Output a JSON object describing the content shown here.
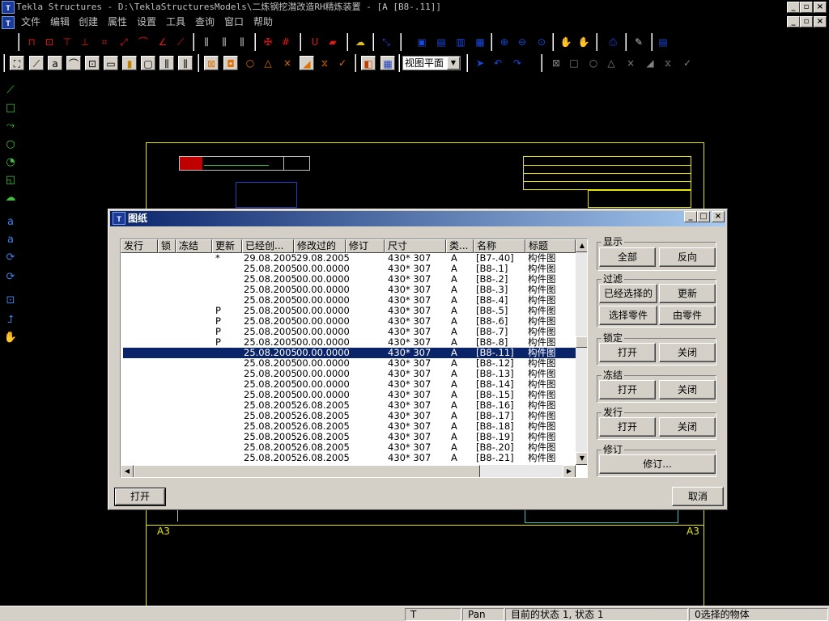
{
  "window": {
    "title": "Tekla Structures - D:\\TeklaStructuresModels\\二炼钢挖潜改造RH精炼装置 - [A   [B8-.11]]",
    "app_icon": "tekla-logo-icon"
  },
  "menu": [
    "文件",
    "编辑",
    "创建",
    "属性",
    "设置",
    "工具",
    "查询",
    "窗口",
    "帮助"
  ],
  "toolbar": {
    "view_select": "视图平面"
  },
  "drawing": {
    "sheet_size_left": "A3",
    "sheet_size_right": "A3"
  },
  "dialog": {
    "title": "图纸",
    "columns": [
      "发行",
      "锁",
      "冻结",
      "更新",
      "已经创...",
      "修改过的",
      "修订",
      "尺寸",
      "类...",
      "名称",
      "标题"
    ],
    "rows": [
      {
        "issue": "",
        "lock": "",
        "freeze": "",
        "update": "*",
        "created": "29.08.2005",
        "modified": "29.08.2005",
        "revision": "",
        "size": "430* 307",
        "type": "A",
        "name": "[B7-.40]",
        "title": "构件图",
        "selected": false
      },
      {
        "issue": "",
        "lock": "",
        "freeze": "",
        "update": "",
        "created": "25.08.2005",
        "modified": "00.00.0000",
        "revision": "",
        "size": "430* 307",
        "type": "A",
        "name": "[B8-.1]",
        "title": "构件图",
        "selected": false
      },
      {
        "issue": "",
        "lock": "",
        "freeze": "",
        "update": "",
        "created": "25.08.2005",
        "modified": "00.00.0000",
        "revision": "",
        "size": "430* 307",
        "type": "A",
        "name": "[B8-.2]",
        "title": "构件图",
        "selected": false
      },
      {
        "issue": "",
        "lock": "",
        "freeze": "",
        "update": "",
        "created": "25.08.2005",
        "modified": "00.00.0000",
        "revision": "",
        "size": "430* 307",
        "type": "A",
        "name": "[B8-.3]",
        "title": "构件图",
        "selected": false
      },
      {
        "issue": "",
        "lock": "",
        "freeze": "",
        "update": "",
        "created": "25.08.2005",
        "modified": "00.00.0000",
        "revision": "",
        "size": "430* 307",
        "type": "A",
        "name": "[B8-.4]",
        "title": "构件图",
        "selected": false
      },
      {
        "issue": "",
        "lock": "",
        "freeze": "",
        "update": "P",
        "created": "25.08.2005",
        "modified": "00.00.0000",
        "revision": "",
        "size": "430* 307",
        "type": "A",
        "name": "[B8-.5]",
        "title": "构件图",
        "selected": false
      },
      {
        "issue": "",
        "lock": "",
        "freeze": "",
        "update": "P",
        "created": "25.08.2005",
        "modified": "00.00.0000",
        "revision": "",
        "size": "430* 307",
        "type": "A",
        "name": "[B8-.6]",
        "title": "构件图",
        "selected": false
      },
      {
        "issue": "",
        "lock": "",
        "freeze": "",
        "update": "P",
        "created": "25.08.2005",
        "modified": "00.00.0000",
        "revision": "",
        "size": "430* 307",
        "type": "A",
        "name": "[B8-.7]",
        "title": "构件图",
        "selected": false
      },
      {
        "issue": "",
        "lock": "",
        "freeze": "",
        "update": "P",
        "created": "25.08.2005",
        "modified": "00.00.0000",
        "revision": "",
        "size": "430* 307",
        "type": "A",
        "name": "[B8-.8]",
        "title": "构件图",
        "selected": false
      },
      {
        "issue": "",
        "lock": "",
        "freeze": "",
        "update": "",
        "created": "25.08.2005",
        "modified": "00.00.0000",
        "revision": "",
        "size": "430* 307",
        "type": "A",
        "name": "[B8-.11]",
        "title": "构件图",
        "selected": true
      },
      {
        "issue": "",
        "lock": "",
        "freeze": "",
        "update": "",
        "created": "25.08.2005",
        "modified": "00.00.0000",
        "revision": "",
        "size": "430* 307",
        "type": "A",
        "name": "[B8-.12]",
        "title": "构件图",
        "selected": false
      },
      {
        "issue": "",
        "lock": "",
        "freeze": "",
        "update": "",
        "created": "25.08.2005",
        "modified": "00.00.0000",
        "revision": "",
        "size": "430* 307",
        "type": "A",
        "name": "[B8-.13]",
        "title": "构件图",
        "selected": false
      },
      {
        "issue": "",
        "lock": "",
        "freeze": "",
        "update": "",
        "created": "25.08.2005",
        "modified": "00.00.0000",
        "revision": "",
        "size": "430* 307",
        "type": "A",
        "name": "[B8-.14]",
        "title": "构件图",
        "selected": false
      },
      {
        "issue": "",
        "lock": "",
        "freeze": "",
        "update": "",
        "created": "25.08.2005",
        "modified": "00.00.0000",
        "revision": "",
        "size": "430* 307",
        "type": "A",
        "name": "[B8-.15]",
        "title": "构件图",
        "selected": false
      },
      {
        "issue": "",
        "lock": "",
        "freeze": "",
        "update": "",
        "created": "25.08.2005",
        "modified": "26.08.2005",
        "revision": "",
        "size": "430* 307",
        "type": "A",
        "name": "[B8-.16]",
        "title": "构件图",
        "selected": false
      },
      {
        "issue": "",
        "lock": "",
        "freeze": "",
        "update": "",
        "created": "25.08.2005",
        "modified": "26.08.2005",
        "revision": "",
        "size": "430* 307",
        "type": "A",
        "name": "[B8-.17]",
        "title": "构件图",
        "selected": false
      },
      {
        "issue": "",
        "lock": "",
        "freeze": "",
        "update": "",
        "created": "25.08.2005",
        "modified": "26.08.2005",
        "revision": "",
        "size": "430* 307",
        "type": "A",
        "name": "[B8-.18]",
        "title": "构件图",
        "selected": false
      },
      {
        "issue": "",
        "lock": "",
        "freeze": "",
        "update": "",
        "created": "25.08.2005",
        "modified": "26.08.2005",
        "revision": "",
        "size": "430* 307",
        "type": "A",
        "name": "[B8-.19]",
        "title": "构件图",
        "selected": false
      },
      {
        "issue": "",
        "lock": "",
        "freeze": "",
        "update": "",
        "created": "25.08.2005",
        "modified": "26.08.2005",
        "revision": "",
        "size": "430* 307",
        "type": "A",
        "name": "[B8-.20]",
        "title": "构件图",
        "selected": false
      },
      {
        "issue": "",
        "lock": "",
        "freeze": "",
        "update": "",
        "created": "25.08.2005",
        "modified": "26.08.2005",
        "revision": "",
        "size": "430* 307",
        "type": "A",
        "name": "[B8-.21]",
        "title": "构件图",
        "selected": false
      }
    ],
    "groups": {
      "display": {
        "label": "显示",
        "btn1": "全部",
        "btn2": "反向"
      },
      "filter": {
        "label": "过滤",
        "btn1": "已经选择的",
        "btn2": "更新",
        "btn3": "选择零件",
        "btn4": "由零件"
      },
      "lock": {
        "label": "锁定",
        "btn1": "打开",
        "btn2": "关闭"
      },
      "freeze": {
        "label": "冻结",
        "btn1": "打开",
        "btn2": "关闭"
      },
      "issue": {
        "label": "发行",
        "btn1": "打开",
        "btn2": "关闭"
      },
      "revision": {
        "label": "修订",
        "btn1": "修订..."
      }
    },
    "open_button": "打开",
    "cancel_button": "取消"
  },
  "statusbar": {
    "cell1": "T",
    "cell2": "Pan",
    "cell3": "目前的状态 1, 状态 1",
    "cell4": "0选择的物体"
  },
  "colors": {
    "title_gradient_start": "#0a246a",
    "title_gradient_end": "#a6caf0",
    "selection": "#0a246a",
    "frame_yellow": "#e6e600"
  }
}
